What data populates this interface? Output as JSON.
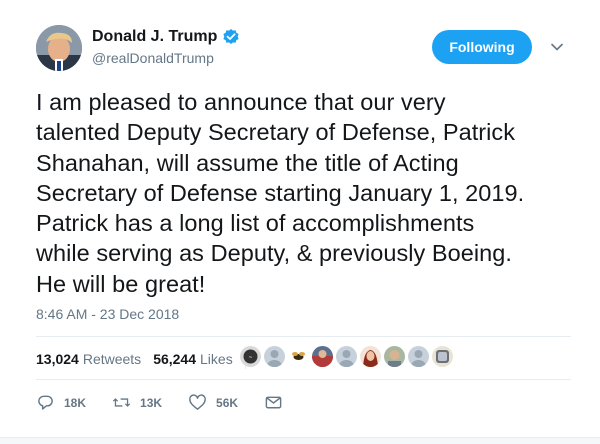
{
  "author": {
    "display_name": "Donald J. Trump",
    "handle": "@realDonaldTrump",
    "verified": true
  },
  "follow_button": {
    "label": "Following"
  },
  "tweet": {
    "lines": [
      "I am pleased to announce that our very",
      "talented Deputy Secretary of Defense, Patrick",
      "Shanahan, will assume the title of Acting",
      "Secretary of Defense starting January 1, 2019.",
      "Patrick has a long list of accomplishments",
      "while serving as Deputy, & previously Boeing.",
      "He will be great!"
    ],
    "timestamp": "8:46 AM - 23 Dec 2018"
  },
  "stats": {
    "retweets_count": "13,024",
    "retweets_label": "Retweets",
    "likes_count": "56,244",
    "likes_label": "Likes"
  },
  "actions": {
    "reply_count": "18K",
    "retweet_count": "13K",
    "like_count": "56K"
  },
  "colors": {
    "accent": "#1da1f2",
    "text": "#14171a",
    "muted": "#657786",
    "divider": "#e6ecf0"
  },
  "icons": [
    "verified-badge-icon",
    "chevron-down-icon",
    "reply-icon",
    "retweet-icon",
    "like-heart-icon",
    "direct-message-icon"
  ]
}
